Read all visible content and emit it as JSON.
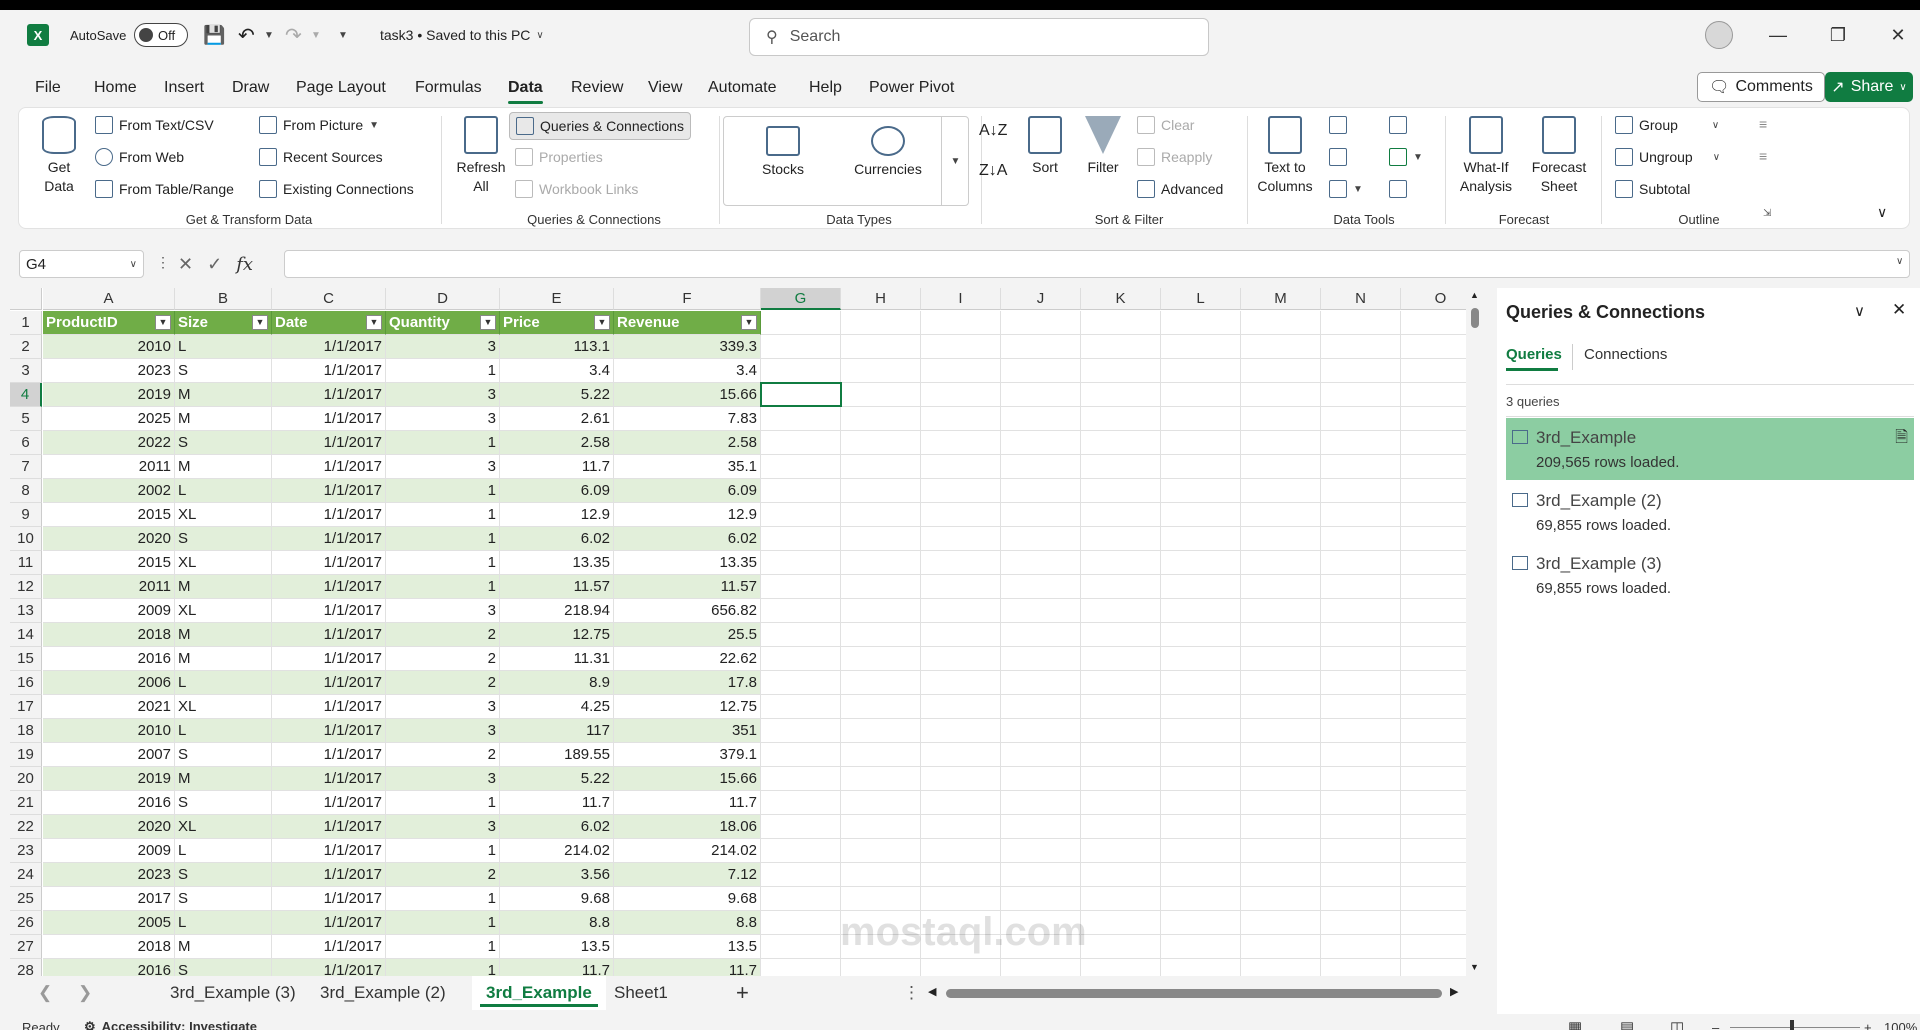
{
  "titlebar": {
    "autosave_label": "AutoSave",
    "autosave_state": "Off",
    "doc_title": "task3 • Saved to this PC",
    "search_placeholder": "Search"
  },
  "menu": {
    "tabs": [
      "File",
      "Home",
      "Insert",
      "Draw",
      "Page Layout",
      "Formulas",
      "Data",
      "Review",
      "View",
      "Automate",
      "Help",
      "Power Pivot"
    ],
    "active": "Data",
    "comments": "Comments",
    "share": "Share"
  },
  "ribbon": {
    "get_transform": {
      "get_data": "Get Data",
      "from_text": "From Text/CSV",
      "from_web": "From Web",
      "from_table": "From Table/Range",
      "from_picture": "From Picture",
      "recent_sources": "Recent Sources",
      "existing_connections": "Existing Connections",
      "label": "Get & Transform Data"
    },
    "queries": {
      "refresh_all": "Refresh All",
      "queries_connections": "Queries & Connections",
      "properties": "Properties",
      "workbook_links": "Workbook Links",
      "label": "Queries & Connections"
    },
    "data_types": {
      "stocks": "Stocks",
      "currencies": "Currencies",
      "label": "Data Types"
    },
    "sort_filter": {
      "sort": "Sort",
      "filter": "Filter",
      "clear": "Clear",
      "reapply": "Reapply",
      "advanced": "Advanced",
      "label": "Sort & Filter"
    },
    "data_tools": {
      "text_to_columns": "Text to Columns",
      "label": "Data Tools"
    },
    "forecast": {
      "what_if": "What-If Analysis",
      "forecast_sheet": "Forecast Sheet",
      "label": "Forecast"
    },
    "outline": {
      "group": "Group",
      "ungroup": "Ungroup",
      "subtotal": "Subtotal",
      "label": "Outline"
    }
  },
  "formula_bar": {
    "name_box": "G4",
    "fx": "fx",
    "value": ""
  },
  "grid": {
    "columns": [
      "A",
      "B",
      "C",
      "D",
      "E",
      "F",
      "G",
      "H",
      "I",
      "J",
      "K",
      "L",
      "M",
      "N",
      "O"
    ],
    "selected_col": "G",
    "selected_row": 4,
    "headers": [
      "ProductID",
      "Size",
      "Date",
      "Quantity",
      "Price",
      "Revenue"
    ],
    "rows": [
      [
        "2010",
        "L",
        "1/1/2017",
        "3",
        "113.1",
        "339.3"
      ],
      [
        "2023",
        "S",
        "1/1/2017",
        "1",
        "3.4",
        "3.4"
      ],
      [
        "2019",
        "M",
        "1/1/2017",
        "3",
        "5.22",
        "15.66"
      ],
      [
        "2025",
        "M",
        "1/1/2017",
        "3",
        "2.61",
        "7.83"
      ],
      [
        "2022",
        "S",
        "1/1/2017",
        "1",
        "2.58",
        "2.58"
      ],
      [
        "2011",
        "M",
        "1/1/2017",
        "3",
        "11.7",
        "35.1"
      ],
      [
        "2002",
        "L",
        "1/1/2017",
        "1",
        "6.09",
        "6.09"
      ],
      [
        "2015",
        "XL",
        "1/1/2017",
        "1",
        "12.9",
        "12.9"
      ],
      [
        "2020",
        "S",
        "1/1/2017",
        "1",
        "6.02",
        "6.02"
      ],
      [
        "2015",
        "XL",
        "1/1/2017",
        "1",
        "13.35",
        "13.35"
      ],
      [
        "2011",
        "M",
        "1/1/2017",
        "1",
        "11.57",
        "11.57"
      ],
      [
        "2009",
        "XL",
        "1/1/2017",
        "3",
        "218.94",
        "656.82"
      ],
      [
        "2018",
        "M",
        "1/1/2017",
        "2",
        "12.75",
        "25.5"
      ],
      [
        "2016",
        "M",
        "1/1/2017",
        "2",
        "11.31",
        "22.62"
      ],
      [
        "2006",
        "L",
        "1/1/2017",
        "2",
        "8.9",
        "17.8"
      ],
      [
        "2021",
        "XL",
        "1/1/2017",
        "3",
        "4.25",
        "12.75"
      ],
      [
        "2010",
        "L",
        "1/1/2017",
        "3",
        "117",
        "351"
      ],
      [
        "2007",
        "S",
        "1/1/2017",
        "2",
        "189.55",
        "379.1"
      ],
      [
        "2019",
        "M",
        "1/1/2017",
        "3",
        "5.22",
        "15.66"
      ],
      [
        "2016",
        "S",
        "1/1/2017",
        "1",
        "11.7",
        "11.7"
      ],
      [
        "2020",
        "XL",
        "1/1/2017",
        "3",
        "6.02",
        "18.06"
      ],
      [
        "2009",
        "L",
        "1/1/2017",
        "1",
        "214.02",
        "214.02"
      ],
      [
        "2023",
        "S",
        "1/1/2017",
        "2",
        "3.56",
        "7.12"
      ],
      [
        "2017",
        "S",
        "1/1/2017",
        "1",
        "9.68",
        "9.68"
      ],
      [
        "2005",
        "L",
        "1/1/2017",
        "1",
        "8.8",
        "8.8"
      ],
      [
        "2018",
        "M",
        "1/1/2017",
        "1",
        "13.5",
        "13.5"
      ],
      [
        "2016",
        "S",
        "1/1/2017",
        "1",
        "11.7",
        "11.7"
      ]
    ]
  },
  "sheets": {
    "tabs": [
      "3rd_Example (3)",
      "3rd_Example (2)",
      "3rd_Example",
      "Sheet1"
    ],
    "active": "3rd_Example"
  },
  "status": {
    "ready": "Ready",
    "accessibility": "Accessibility: Investigate",
    "zoom": "100%"
  },
  "queries_panel": {
    "title": "Queries & Connections",
    "tabs": [
      "Queries",
      "Connections"
    ],
    "count": "3 queries",
    "items": [
      {
        "name": "3rd_Example",
        "rows": "209,565 rows loaded."
      },
      {
        "name": "3rd_Example (2)",
        "rows": "69,855 rows loaded."
      },
      {
        "name": "3rd_Example (3)",
        "rows": "69,855 rows loaded."
      }
    ]
  },
  "watermark": "mostaql.com",
  "colors": {
    "accent": "#107c41",
    "table_header": "#70ad47",
    "band": "#e2efda",
    "query_selected": "#8ccda2"
  }
}
